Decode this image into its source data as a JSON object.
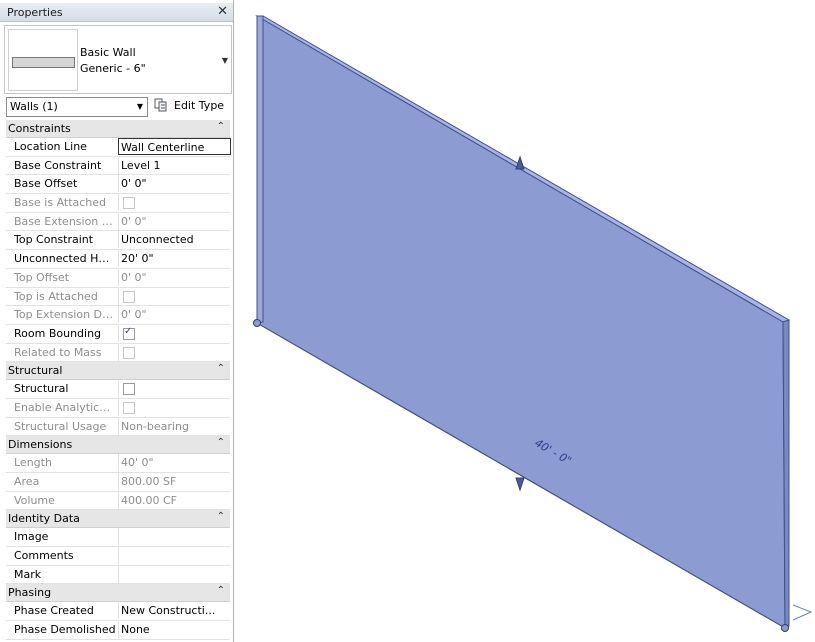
{
  "palette": {
    "title": "Properties",
    "close_glyph": "✕",
    "type": {
      "family": "Basic Wall",
      "name": "Generic - 6\""
    },
    "instance_filter": "Walls (1)",
    "edit_type_label": "Edit Type"
  },
  "groups": [
    {
      "label": "Constraints",
      "collapse": "⌃",
      "rows": [
        {
          "name": "Location Line",
          "value": "Wall Centerline",
          "readonly": false,
          "selected": true
        },
        {
          "name": "Base Constraint",
          "value": "Level 1",
          "readonly": false
        },
        {
          "name": "Base Offset",
          "value": "0'  0\"",
          "readonly": false
        },
        {
          "name": "Base is Attached",
          "check": false,
          "readonly": true
        },
        {
          "name": "Base Extension Di...",
          "value": "0'  0\"",
          "readonly": true
        },
        {
          "name": "Top Constraint",
          "value": "Unconnected",
          "readonly": false
        },
        {
          "name": "Unconnected Hei...",
          "value": "20'  0\"",
          "readonly": false
        },
        {
          "name": "Top Offset",
          "value": "0'  0\"",
          "readonly": true
        },
        {
          "name": "Top is Attached",
          "check": false,
          "readonly": true
        },
        {
          "name": "Top Extension Dis...",
          "value": "0'  0\"",
          "readonly": true
        },
        {
          "name": "Room Bounding",
          "check": true,
          "readonly": false
        },
        {
          "name": "Related to Mass",
          "check": false,
          "readonly": true
        }
      ]
    },
    {
      "label": "Structural",
      "collapse": "⌃",
      "rows": [
        {
          "name": "Structural",
          "check": false,
          "readonly": false
        },
        {
          "name": "Enable Analytical ...",
          "check": false,
          "readonly": true
        },
        {
          "name": "Structural Usage",
          "value": "Non-bearing",
          "readonly": true
        }
      ]
    },
    {
      "label": "Dimensions",
      "collapse": "⌃",
      "rows": [
        {
          "name": "Length",
          "value": "40'  0\"",
          "readonly": true
        },
        {
          "name": "Area",
          "value": "800.00 SF",
          "readonly": true
        },
        {
          "name": "Volume",
          "value": "400.00 CF",
          "readonly": true
        }
      ]
    },
    {
      "label": "Identity Data",
      "collapse": "⌃",
      "rows": [
        {
          "name": "Image",
          "value": "",
          "readonly": false
        },
        {
          "name": "Comments",
          "value": "",
          "readonly": false
        },
        {
          "name": "Mark",
          "value": "",
          "readonly": false
        }
      ]
    },
    {
      "label": "Phasing",
      "collapse": "⌃",
      "rows": [
        {
          "name": "Phase Created",
          "value": "New Constructi...",
          "readonly": false
        },
        {
          "name": "Phase Demolished",
          "value": "None",
          "readonly": false
        }
      ]
    }
  ],
  "viewport": {
    "dimension_label": "40' - 0\"",
    "wall_color": "#8c9bd1",
    "edge_color": "#3f4f8c"
  }
}
